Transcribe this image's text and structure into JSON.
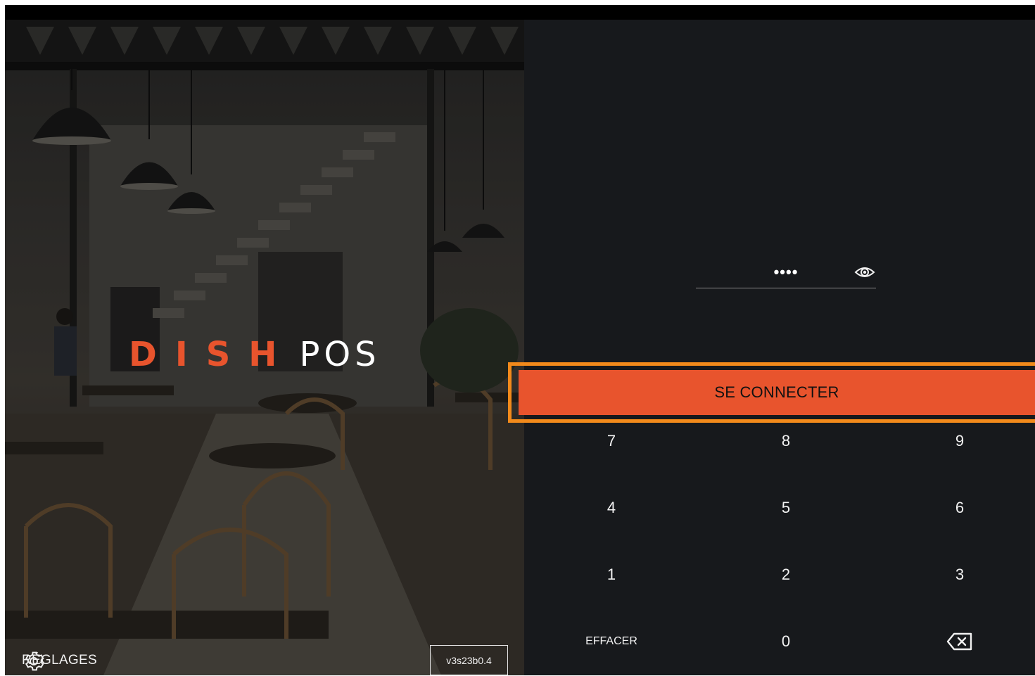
{
  "brand": {
    "part1": "DISH",
    "part2": "POS"
  },
  "settings": {
    "label": "RÉGLAGES",
    "icon": "gear-icon"
  },
  "version": "v3s23b0.4",
  "pin": {
    "masked_value": "••••",
    "reveal_icon": "eye-icon"
  },
  "connect_button": "SE CONNECTER",
  "keypad": {
    "rows": [
      [
        "7",
        "8",
        "9"
      ],
      [
        "4",
        "5",
        "6"
      ],
      [
        "1",
        "2",
        "3"
      ]
    ],
    "clear_label": "EFFACER",
    "zero": "0",
    "backspace_icon": "backspace-icon"
  },
  "colors": {
    "accent": "#e8542d",
    "highlight_border": "#f28a1b",
    "panel_bg": "#17191c"
  }
}
